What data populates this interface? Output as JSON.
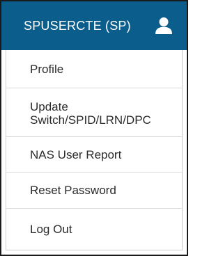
{
  "header": {
    "username": "SPUSERCTE (SP)",
    "icon": "user-icon",
    "background_color": "#0b5d8c"
  },
  "menu": {
    "items": [
      {
        "label": "Profile"
      },
      {
        "label": "Update",
        "label_line2": "Switch/SPID/LRN/DPC"
      },
      {
        "label": "NAS User Report"
      },
      {
        "label": "Reset Password"
      },
      {
        "label": "Log Out"
      }
    ]
  }
}
